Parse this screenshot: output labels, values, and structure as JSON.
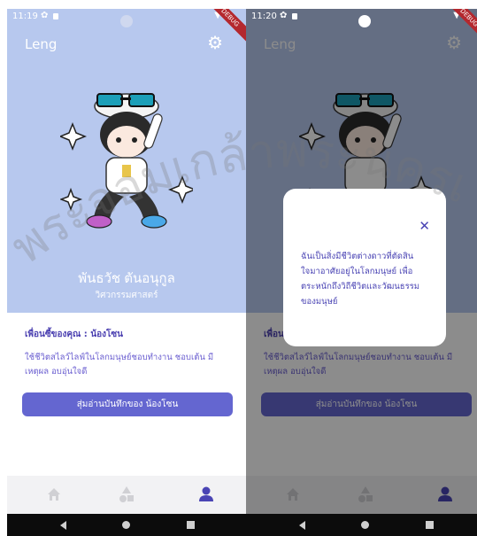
{
  "status_left": {
    "time": "11:19"
  },
  "status_right": {
    "time": "11:20"
  },
  "debug_label": "DEBUG",
  "app": {
    "title": "Leng"
  },
  "profile": {
    "name": "พันธวัช ตันอนุกูล",
    "faculty": "วิศวกรรมศาสตร์"
  },
  "best_friend": {
    "label": "เพื่อนซี้ของคุณ : ",
    "name": "น้องโซน",
    "description": "ใช้ชีวิตสไลว์ไลฟ์ในโลกมนุษย์ชอบทำงาน ชอบเต้น มีเหตุผล อบอุ่นใจดี"
  },
  "action_button": {
    "label": "สุ่มอ่านบันทึกของ น้องโซน"
  },
  "dialog": {
    "text": "ฉันเป็นสิ่งมีชีวิตต่างดาวที่ตัดสินใจมาอาศัยอยู่ในโลกมนุษย์ เพื่อตระหนักถึงวิถีชีวิตและวัฒนธรรมของมนุษย์"
  },
  "watermark_text": "พระจอมเกล้าพระนครเหนือ",
  "icons": {
    "settings": "gear-icon",
    "nav": [
      "home-icon",
      "shapes-icon",
      "profile-icon"
    ],
    "close": "close-icon"
  },
  "colors": {
    "header_bg": "#b7c8ee",
    "accent": "#6466d0",
    "text_accent": "#4a3fb0",
    "active_nav": "#4a44b4",
    "inactive_nav": "#d0d0d4"
  }
}
